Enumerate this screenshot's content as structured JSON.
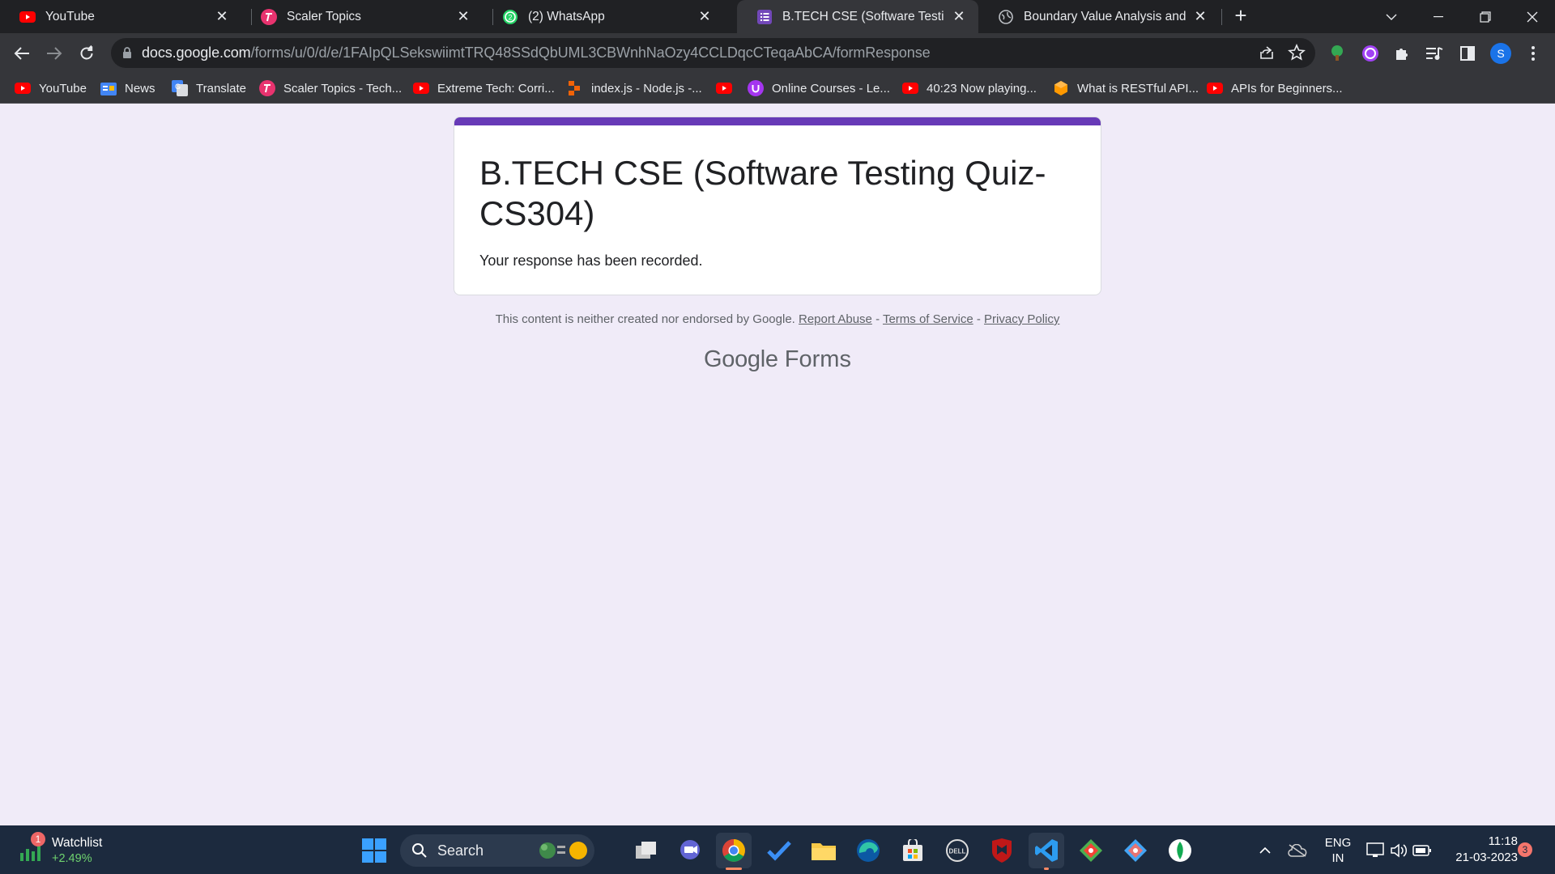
{
  "tabs": [
    {
      "title": "YouTube",
      "icon": "youtube-icon"
    },
    {
      "title": "Scaler Topics",
      "icon": "scaler-icon"
    },
    {
      "title": "(2) WhatsApp",
      "icon": "whatsapp-icon"
    },
    {
      "title": "B.TECH CSE (Software Testing Qu",
      "icon": "google-forms-icon",
      "active": true
    },
    {
      "title": "Boundary Value Analysis and Equ",
      "icon": "globe-icon"
    }
  ],
  "address_bar": {
    "host": "docs.google.com",
    "path": "/forms/u/0/d/e/1FAIpQLSekswiimtTRQ48SSdQbUML3CBWnhNaOzy4CCLDqcCTeqaAbCA/formResponse"
  },
  "profile_initial": "S",
  "bookmarks": [
    {
      "label": "YouTube",
      "icon": "youtube-icon"
    },
    {
      "label": "News",
      "icon": "google-news-icon"
    },
    {
      "label": "Translate",
      "icon": "google-translate-icon"
    },
    {
      "label": "Scaler Topics - Tech...",
      "icon": "scaler-icon"
    },
    {
      "label": "Extreme Tech: Corri...",
      "icon": "youtube-icon"
    },
    {
      "label": "index.js - Node.js -...",
      "icon": "replit-icon"
    },
    {
      "label": "",
      "icon": "youtube-icon"
    },
    {
      "label": "Online Courses - Le...",
      "icon": "udemy-icon"
    },
    {
      "label": "40:23 Now playing...",
      "icon": "youtube-icon"
    },
    {
      "label": "What is RESTful API...",
      "icon": "aws-icon"
    },
    {
      "label": "APIs for Beginners...",
      "icon": "youtube-icon"
    }
  ],
  "form": {
    "title": "B.TECH CSE (Software Testing Quiz-CS304)",
    "confirmation": "Your response has been recorded.",
    "accent_color": "#673ab7"
  },
  "footer": {
    "disclaimer": "This content is neither created nor endorsed by Google.",
    "report_abuse": "Report Abuse",
    "terms": "Terms of Service",
    "privacy": "Privacy Policy",
    "sep": " - ",
    "brand_google": "Google",
    "brand_forms": "Forms"
  },
  "taskbar": {
    "widget_title": "Watchlist",
    "widget_value": "+2.49%",
    "widget_badge": "1",
    "search_label": "Search",
    "language_top": "ENG",
    "language_bottom": "IN",
    "time": "11:18",
    "date": "21-03-2023",
    "notification_count": "3"
  }
}
